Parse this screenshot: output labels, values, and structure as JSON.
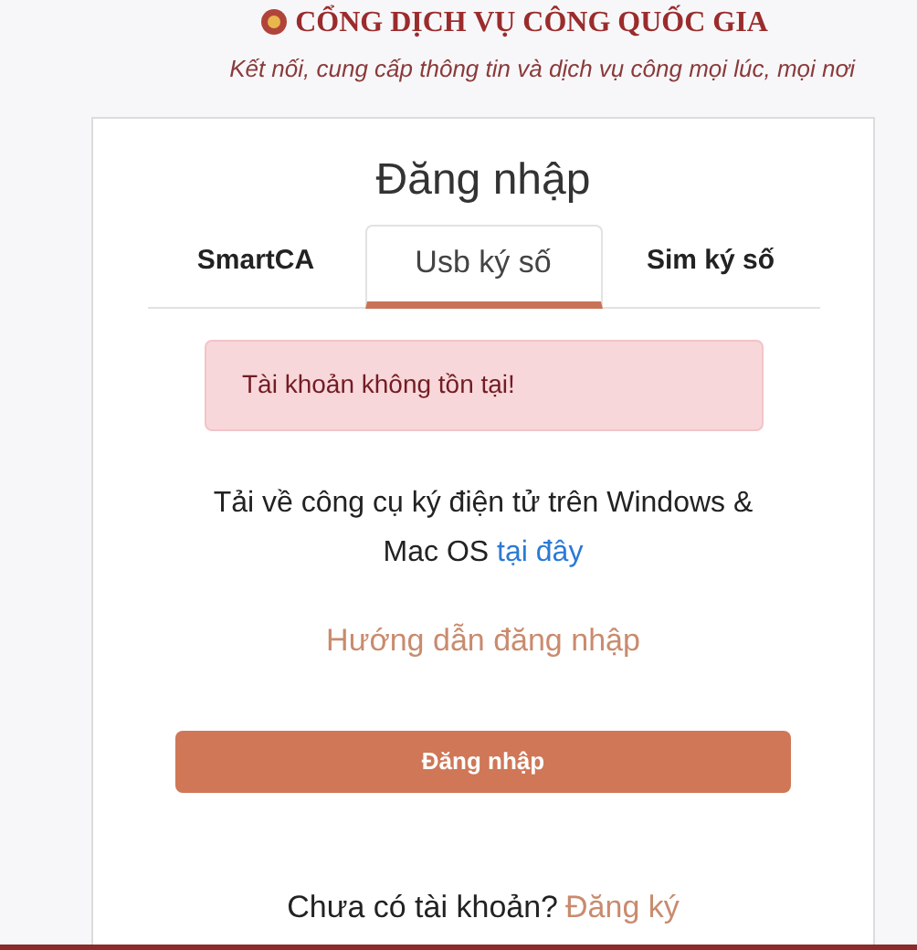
{
  "header": {
    "title": "CỔNG DỊCH VỤ CÔNG QUỐC GIA",
    "subtitle": "Kết nối, cung cấp thông tin và dịch vụ công mọi lúc, mọi nơi"
  },
  "login": {
    "title": "Đăng nhập",
    "tabs": [
      {
        "label": "SmartCA",
        "selected": false
      },
      {
        "label": "Usb ký số",
        "selected": true
      },
      {
        "label": "Sim ký số",
        "selected": false
      }
    ],
    "alert": "Tài khoản không tồn tại!",
    "download_text": "Tải về công cụ ký điện tử trên Windows & Mac OS",
    "download_link": "tại đây",
    "guide_link": "Hướng dẫn đăng nhập",
    "submit": "Đăng nhập",
    "register_prompt": "Chưa có tài khoản?",
    "register_link": "Đăng ký"
  }
}
